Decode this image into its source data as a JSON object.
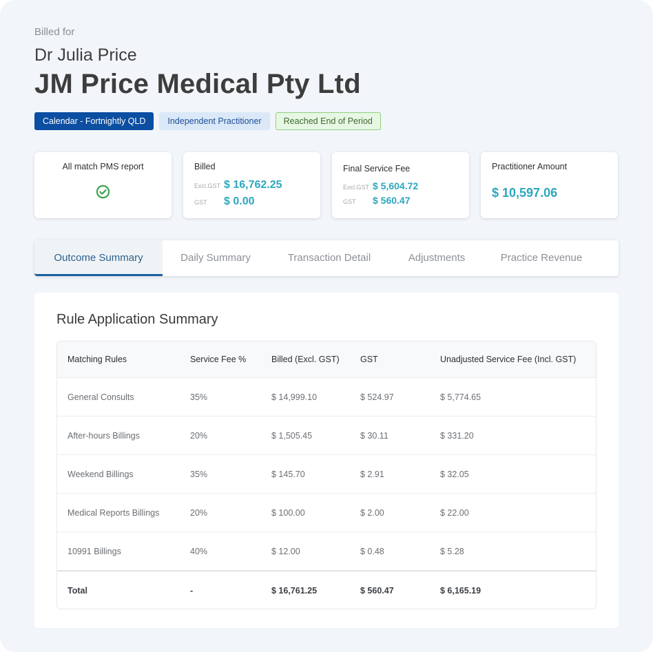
{
  "header": {
    "billed_for_label": "Billed for",
    "person_name": "Dr Julia Price",
    "company_name": "JM Price Medical Pty Ltd"
  },
  "tags": [
    {
      "label": "Calendar - Fortnightly QLD"
    },
    {
      "label": "Independent Practitioner"
    },
    {
      "label": "Reached End of Period"
    }
  ],
  "cards": {
    "pms": {
      "title": "All match PMS report",
      "icon": "check-circle-icon",
      "status": "match"
    },
    "billed": {
      "title": "Billed",
      "excl_label": "Excl.GST",
      "excl_value": "$ 16,762.25",
      "gst_label": "GST",
      "gst_value": "$ 0.00"
    },
    "service_fee": {
      "title": "Final Service Fee",
      "excl_label": "Excl.GST",
      "excl_value": "$ 5,604.72",
      "gst_label": "GST",
      "gst_value": "$ 560.47"
    },
    "practitioner": {
      "title": "Practitioner Amount",
      "value": "$ 10,597.06"
    }
  },
  "tabs": [
    {
      "label": "Outcome Summary",
      "active": true
    },
    {
      "label": "Daily Summary",
      "active": false
    },
    {
      "label": "Transaction Detail",
      "active": false
    },
    {
      "label": "Adjustments",
      "active": false
    },
    {
      "label": "Practice Revenue",
      "active": false
    }
  ],
  "summary": {
    "title": "Rule Application Summary",
    "columns": [
      "Matching Rules",
      "Service Fee %",
      "Billed (Excl. GST)",
      "GST",
      "Unadjusted Service Fee (Incl. GST)"
    ],
    "rows": [
      [
        "General Consults",
        "35%",
        "$ 14,999.10",
        "$ 524.97",
        "$ 5,774.65"
      ],
      [
        "After-hours Billings",
        "20%",
        "$ 1,505.45",
        "$ 30.11",
        "$ 331.20"
      ],
      [
        "Weekend Billings",
        "35%",
        "$ 145.70",
        "$ 2.91",
        "$ 32.05"
      ],
      [
        "Medical Reports Billings",
        "20%",
        "$ 100.00",
        "$ 2.00",
        "$ 22.00"
      ],
      [
        "10991 Billings",
        "40%",
        "$ 12.00",
        "$ 0.48",
        "$ 5.28"
      ]
    ],
    "total": [
      "Total",
      "-",
      "$ 16,761.25",
      "$ 560.47",
      "$ 6,165.19"
    ]
  },
  "colors": {
    "brand_blue": "#0b4ea2",
    "amount_teal": "#2ba7bd",
    "success_green": "#3aa64a",
    "tab_active": "#1b5fa0"
  }
}
